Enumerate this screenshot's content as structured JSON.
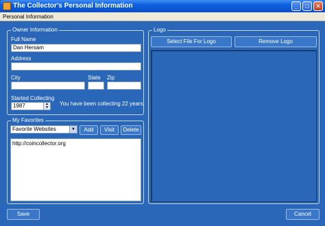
{
  "window": {
    "title": "The Collector's Personal Information",
    "minimize_glyph": "_",
    "maximize_glyph": "□",
    "close_glyph": "✕"
  },
  "menu": {
    "item": "Personal Information"
  },
  "owner": {
    "legend": "Owner Information",
    "full_name_label": "Full Name",
    "full_name_value": "Dan Hersam",
    "address_label": "Address",
    "address_value": "",
    "city_label": "City",
    "city_value": "",
    "state_label": "State",
    "state_value": "",
    "zip_label": "Zip",
    "zip_value": "",
    "started_label": "Started Collecting",
    "started_value": "1987",
    "collecting_message": "You have been collecting 22 years."
  },
  "favorites": {
    "legend": "My Favorites",
    "selected_category": "Favorite Websites",
    "add_label": "Add",
    "visit_label": "Visit",
    "delete_label": "Delete",
    "items": [
      "http://coincollector.org"
    ]
  },
  "logo": {
    "legend": "Logo",
    "select_file_label": "Select File For Logo",
    "remove_label": "Remove Logo"
  },
  "footer": {
    "save_label": "Save",
    "cancel_label": "Cancel"
  },
  "icons": {
    "spin_up": "▲",
    "spin_down": "▼",
    "dropdown": "▼"
  }
}
